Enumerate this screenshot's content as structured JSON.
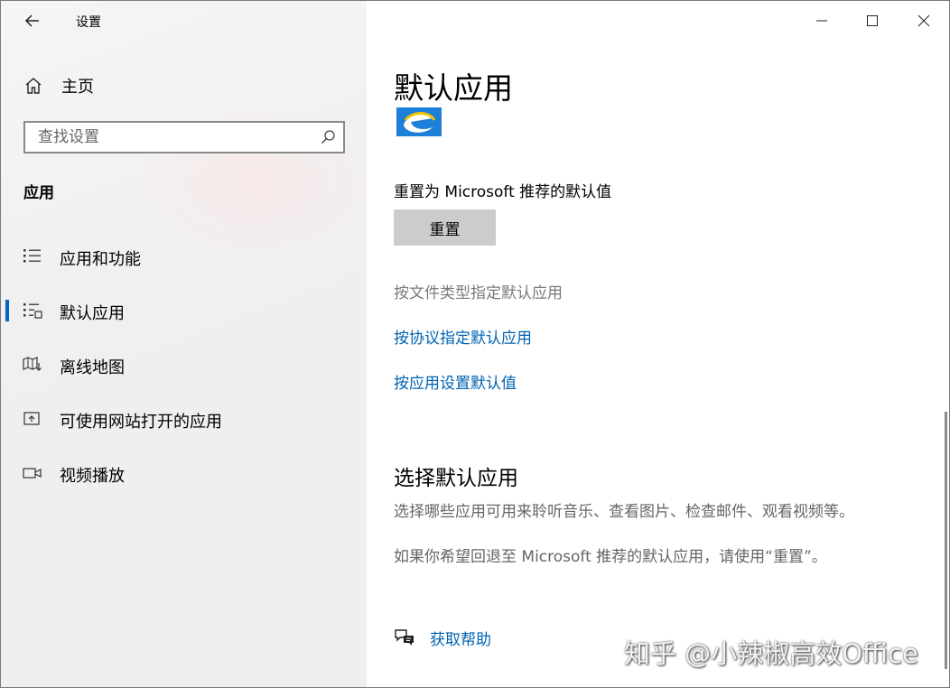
{
  "window": {
    "title": "设置"
  },
  "sidebar": {
    "home_label": "主页",
    "search_placeholder": "查找设置",
    "section_title": "应用",
    "items": [
      {
        "label": "应用和功能",
        "icon": "apps-features-icon",
        "active": false
      },
      {
        "label": "默认应用",
        "icon": "default-apps-icon",
        "active": true
      },
      {
        "label": "离线地图",
        "icon": "offline-maps-icon",
        "active": false
      },
      {
        "label": "可使用网站打开的应用",
        "icon": "apps-for-websites-icon",
        "active": false
      },
      {
        "label": "视频播放",
        "icon": "video-playback-icon",
        "active": false
      }
    ]
  },
  "main": {
    "page_title": "默认应用",
    "reset_label": "重置为 Microsoft 推荐的默认值",
    "reset_button": "重置",
    "link_file_type": "按文件类型指定默认应用",
    "link_protocol": "按协议指定默认应用",
    "link_app_defaults": "按应用设置默认值",
    "section_title": "选择默认应用",
    "desc1": "选择哪些应用可用来聆听音乐、查看图片、检查邮件、观看视频等。",
    "desc2": "如果你希望回退至 Microsoft 推荐的默认应用，请使用“重置”。",
    "help_label": "获取帮助"
  },
  "watermark": "知乎 @小辣椒高效Office",
  "colors": {
    "accent": "#0067c0",
    "link": "#0063b1",
    "sidebar_bg": "#f2f1f1",
    "button_bg": "#cccccc"
  }
}
